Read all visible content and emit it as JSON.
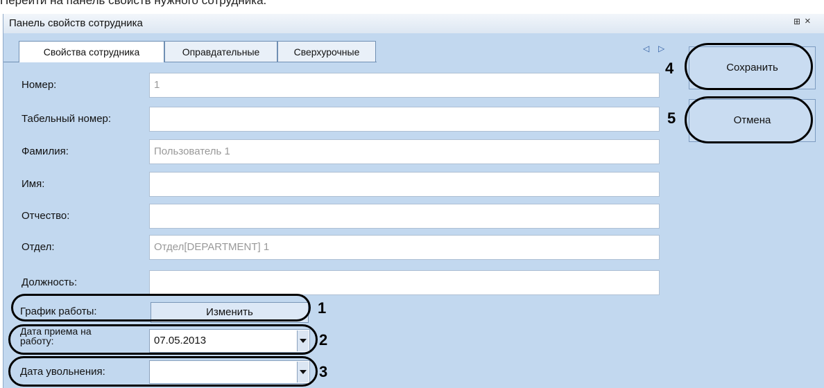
{
  "caption": "Перейти на панель свойств нужного сотрудника.",
  "window": {
    "title": "Панель свойств сотрудника",
    "pin_glyph": "⊞",
    "close_glyph": "×"
  },
  "tabs": [
    {
      "label": "Свойства сотрудника",
      "active": true
    },
    {
      "label": "Оправдательные",
      "active": false
    },
    {
      "label": "Сверхурочные",
      "active": false
    }
  ],
  "tab_nav": {
    "left": "◁",
    "right": "▷"
  },
  "fields": {
    "number": {
      "label": "Номер:",
      "value": "1"
    },
    "tab_number": {
      "label": "Табельный номер:",
      "value": ""
    },
    "surname": {
      "label": "Фамилия:",
      "value": "Пользователь 1"
    },
    "name": {
      "label": "Имя:",
      "value": ""
    },
    "patronymic": {
      "label": "Отчество:",
      "value": ""
    },
    "department": {
      "label": "Отдел:",
      "value": "Отдел[DEPARTMENT] 1"
    },
    "position": {
      "label": "Должность:",
      "value": ""
    }
  },
  "schedule": {
    "label": "График работы:",
    "button": "Изменить"
  },
  "hire_date": {
    "label_line1": "Дата приема на",
    "label_line2": "работу:",
    "value": "07.05.2013"
  },
  "dismissal_date": {
    "label": "Дата увольнения:",
    "value": ""
  },
  "actions": {
    "save": "Сохранить",
    "cancel": "Отмена"
  },
  "callouts": {
    "c1": "1",
    "c2": "2",
    "c3": "3",
    "c4": "4",
    "c5": "5"
  },
  "colors": {
    "panel": "#c2d8ef",
    "annotation": "#000000"
  }
}
